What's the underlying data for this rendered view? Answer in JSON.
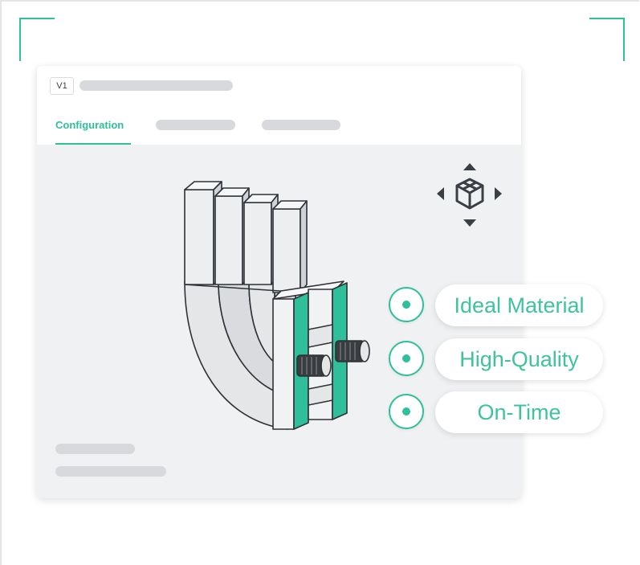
{
  "version_badge": "V1",
  "tabs": [
    {
      "label": "Configuration",
      "active": true
    }
  ],
  "features": [
    {
      "label": "Ideal Material"
    },
    {
      "label": "High-Quality"
    },
    {
      "label": "On-Time"
    }
  ],
  "view_navigator": {
    "icon": "view-cube-icon",
    "arrows": [
      "arrow-up-icon",
      "arrow-left-icon",
      "arrow-right-icon",
      "arrow-down-icon"
    ]
  },
  "colors": {
    "accent": "#2fbf9a",
    "viewport_bg": "#f0f1f3",
    "placeholder": "#d7d9dc"
  }
}
